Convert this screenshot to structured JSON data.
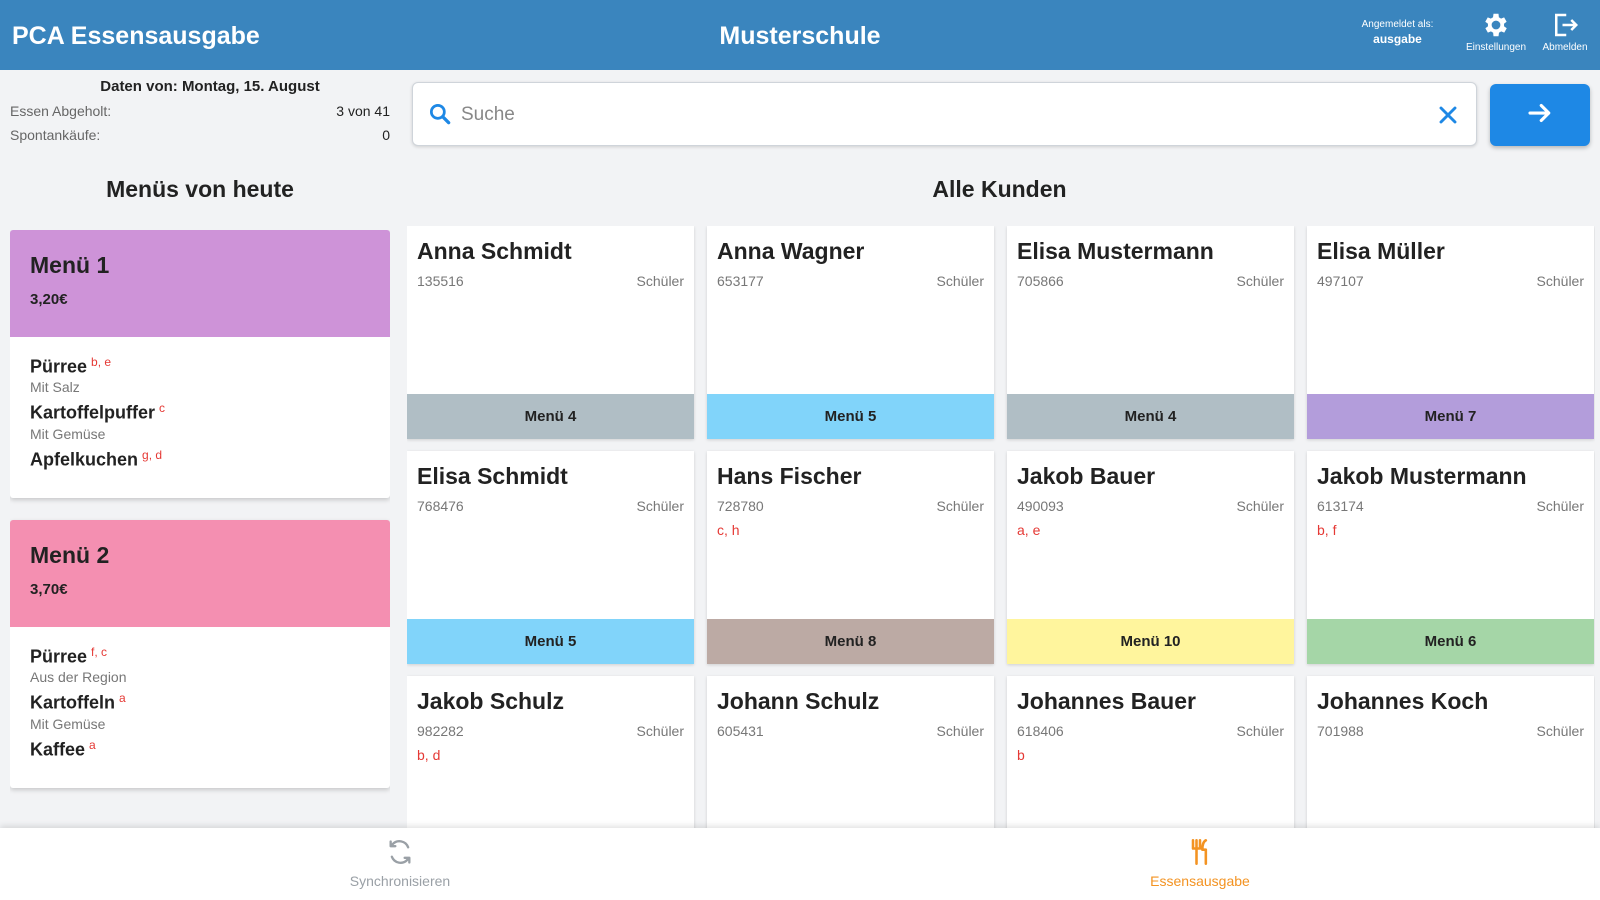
{
  "topbar": {
    "app_title": "PCA Essensausgabe",
    "school": "Musterschule",
    "logged_in_label": "Angemeldet als:",
    "logged_in_user": "ausgabe",
    "settings_label": "Einstellungen",
    "logout_label": "Abmelden",
    "background_color": "#3a85be"
  },
  "stats": {
    "date_label": "Daten von: Montag, 15. August",
    "picked_label": "Essen Abgeholt:",
    "picked_value": "3 von 41",
    "spontaneous_label": "Spontankäufe:",
    "spontaneous_value": "0"
  },
  "search": {
    "placeholder": "Suche",
    "value": ""
  },
  "headings": {
    "menus": "Menüs von heute",
    "customers": "Alle Kunden"
  },
  "menus": [
    {
      "name": "Menü 1",
      "price": "3,20€",
      "color": "#ce93d8",
      "dishes": [
        {
          "name": "Pürree",
          "allergens": "b, e",
          "desc": "Mit Salz"
        },
        {
          "name": "Kartoffelpuffer",
          "allergens": "c",
          "desc": "Mit Gemüse"
        },
        {
          "name": "Apfelkuchen",
          "allergens": "g, d",
          "desc": ""
        }
      ]
    },
    {
      "name": "Menü 2",
      "price": "3,70€",
      "color": "#f48fb1",
      "dishes": [
        {
          "name": "Pürree",
          "allergens": "f, c",
          "desc": "Aus der Region"
        },
        {
          "name": "Kartoffeln",
          "allergens": "a",
          "desc": "Mit Gemüse"
        },
        {
          "name": "Kaffee",
          "allergens": "a",
          "desc": ""
        }
      ]
    }
  ],
  "customers": [
    {
      "name": "Anna Schmidt",
      "id": "135516",
      "type": "Schüler",
      "allergies": "",
      "menu": "Menü 4",
      "menu_color": "#b0bec5"
    },
    {
      "name": "Anna Wagner",
      "id": "653177",
      "type": "Schüler",
      "allergies": "",
      "menu": "Menü 5",
      "menu_color": "#81d4fa"
    },
    {
      "name": "Elisa Mustermann",
      "id": "705866",
      "type": "Schüler",
      "allergies": "",
      "menu": "Menü 4",
      "menu_color": "#b0bec5"
    },
    {
      "name": "Elisa Müller",
      "id": "497107",
      "type": "Schüler",
      "allergies": "",
      "menu": "Menü 7",
      "menu_color": "#b39ddb"
    },
    {
      "name": "Elisa Schmidt",
      "id": "768476",
      "type": "Schüler",
      "allergies": "",
      "menu": "Menü 5",
      "menu_color": "#81d4fa"
    },
    {
      "name": "Hans Fischer",
      "id": "728780",
      "type": "Schüler",
      "allergies": "c, h",
      "menu": "Menü 8",
      "menu_color": "#bcaaa4"
    },
    {
      "name": "Jakob Bauer",
      "id": "490093",
      "type": "Schüler",
      "allergies": "a, e",
      "menu": "Menü 10",
      "menu_color": "#fff59d"
    },
    {
      "name": "Jakob Mustermann",
      "id": "613174",
      "type": "Schüler",
      "allergies": "b, f",
      "menu": "Menü 6",
      "menu_color": "#a5d6a7"
    },
    {
      "name": "Jakob Schulz",
      "id": "982282",
      "type": "Schüler",
      "allergies": "b, d",
      "menu": "",
      "menu_color": ""
    },
    {
      "name": "Johann Schulz",
      "id": "605431",
      "type": "Schüler",
      "allergies": "",
      "menu": "",
      "menu_color": ""
    },
    {
      "name": "Johannes Bauer",
      "id": "618406",
      "type": "Schüler",
      "allergies": "b",
      "menu": "",
      "menu_color": ""
    },
    {
      "name": "Johannes Koch",
      "id": "701988",
      "type": "Schüler",
      "allergies": "",
      "menu": "",
      "menu_color": ""
    }
  ],
  "bottomnav": {
    "sync_label": "Synchronisieren",
    "serve_label": "Essensausgabe",
    "active_color": "#f39322",
    "inactive_color": "#9aa0a6"
  },
  "icons": {
    "search": "search-icon",
    "clear": "close-icon",
    "go": "arrow-right-icon",
    "settings": "gear-icon",
    "logout": "logout-icon",
    "sync": "sync-icon",
    "serve": "cutlery-icon"
  }
}
